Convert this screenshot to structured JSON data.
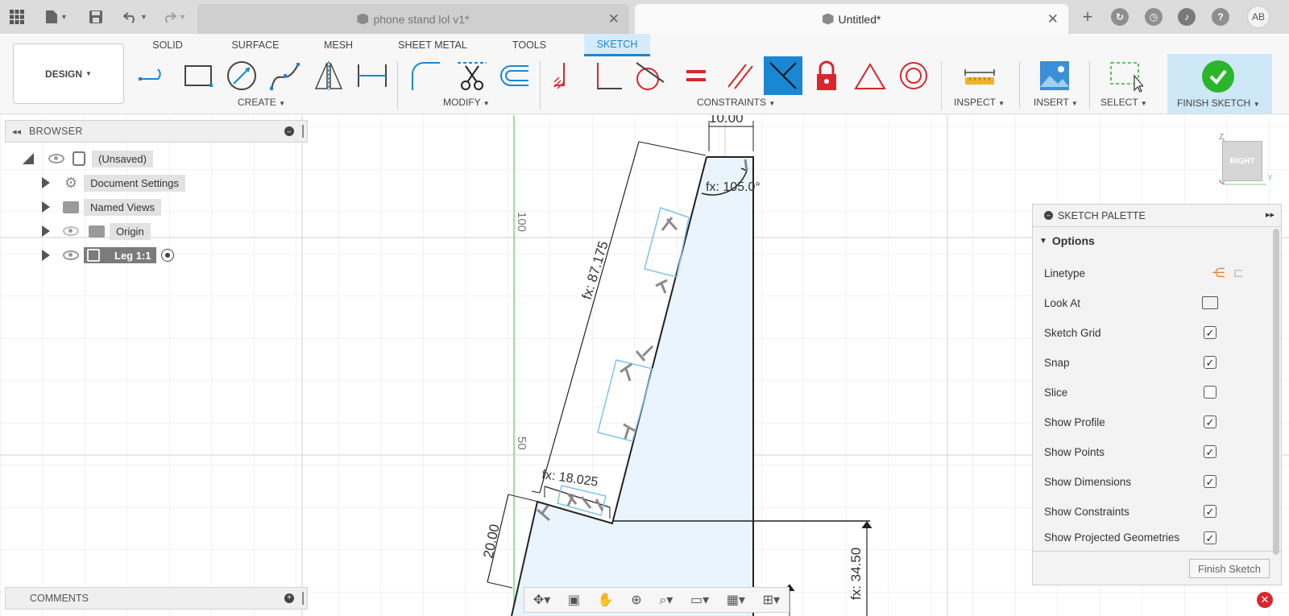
{
  "titlebar": {
    "tabs": [
      {
        "label": "phone stand lol v1*"
      },
      {
        "label": "Untitled*"
      }
    ],
    "avatar": "AB"
  },
  "ribbon": {
    "workspace": "DESIGN",
    "tabs": [
      "SOLID",
      "SURFACE",
      "MESH",
      "SHEET METAL",
      "TOOLS",
      "SKETCH"
    ],
    "active_tab": "SKETCH",
    "groups": {
      "create": "CREATE",
      "modify": "MODIFY",
      "constraints": "CONSTRAINTS",
      "inspect": "INSPECT",
      "insert": "INSERT",
      "select": "SELECT",
      "finish": "FINISH SKETCH"
    }
  },
  "browser": {
    "title": "BROWSER",
    "root": "(Unsaved)",
    "items": [
      {
        "label": "Document Settings"
      },
      {
        "label": "Named Views"
      },
      {
        "label": "Origin"
      },
      {
        "label": "Leg 1:1"
      }
    ]
  },
  "comments": {
    "title": "COMMENTS"
  },
  "canvas": {
    "dims": {
      "top_width": "10.00",
      "angle": "fx: 105.0°",
      "slant_length": "fx: 87.175",
      "step_length": "fx: 18.025",
      "step_height": "20.00",
      "height": "fx: 34.50"
    },
    "ruler": {
      "mark_100": "100",
      "mark_50": "50"
    }
  },
  "viewcube": {
    "face": "RIGHT"
  },
  "palette": {
    "title": "SKETCH PALETTE",
    "section": "Options",
    "options": [
      {
        "label": "Linetype"
      },
      {
        "label": "Look At"
      },
      {
        "label": "Sketch Grid",
        "checked": true
      },
      {
        "label": "Snap",
        "checked": true
      },
      {
        "label": "Slice",
        "checked": false
      },
      {
        "label": "Show Profile",
        "checked": true
      },
      {
        "label": "Show Points",
        "checked": true
      },
      {
        "label": "Show Dimensions",
        "checked": true
      },
      {
        "label": "Show Constraints",
        "checked": true
      },
      {
        "label": "Show Projected Geometries",
        "checked": true
      }
    ],
    "finish_button": "Finish Sketch"
  },
  "colors": {
    "accent": "#1a87d4",
    "finish_green": "#2bb52b",
    "constraint_red": "#d9262c",
    "profile_fill": "#eaf4fc"
  }
}
